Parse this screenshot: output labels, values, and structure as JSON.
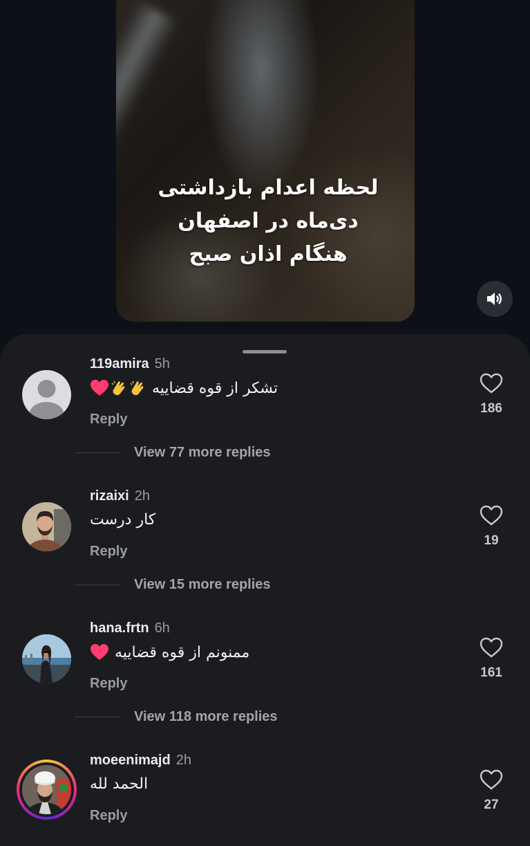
{
  "video": {
    "caption_lines": [
      "لحظه اعدام بازداشتی",
      "دی‌ماه در اصفهان",
      "هنگام اذان صبح"
    ]
  },
  "sound_button": {
    "icon": "speaker-icon"
  },
  "comments": [
    {
      "username": "119amira",
      "time": "5h",
      "text": "تشکر از قوه قضاییه",
      "emojis": [
        "clap",
        "clap",
        "heart"
      ],
      "reply_label": "Reply",
      "likes": "186",
      "view_replies": "View 77 more replies",
      "avatar": "default-avatar"
    },
    {
      "username": "rizaixi",
      "time": "2h",
      "text": "کار درست",
      "emojis": [],
      "reply_label": "Reply",
      "likes": "19",
      "view_replies": "View 15 more replies",
      "avatar": "man-beard-avatar"
    },
    {
      "username": "hana.frtn",
      "time": "6h",
      "text": "ممنونم از قوه قضاییه",
      "emojis": [
        "heart"
      ],
      "reply_label": "Reply",
      "likes": "161",
      "view_replies": "View 118 more replies",
      "avatar": "woman-sea-avatar"
    },
    {
      "username": "moeenimajd",
      "time": "2h",
      "text": "الحمد لله",
      "emojis": [],
      "reply_label": "Reply",
      "likes": "27",
      "avatar": "cleric-avatar",
      "story_ring": true
    }
  ],
  "colors": {
    "background": "#0d1117",
    "sheet": "#1b1c20",
    "muted_text": "#9a9ca3",
    "heart_emoji": "#ff3d6e",
    "clap_emoji": "#f5c242",
    "story_ring": [
      "#f9ce34",
      "#ee2a7b",
      "#6228d7"
    ]
  }
}
